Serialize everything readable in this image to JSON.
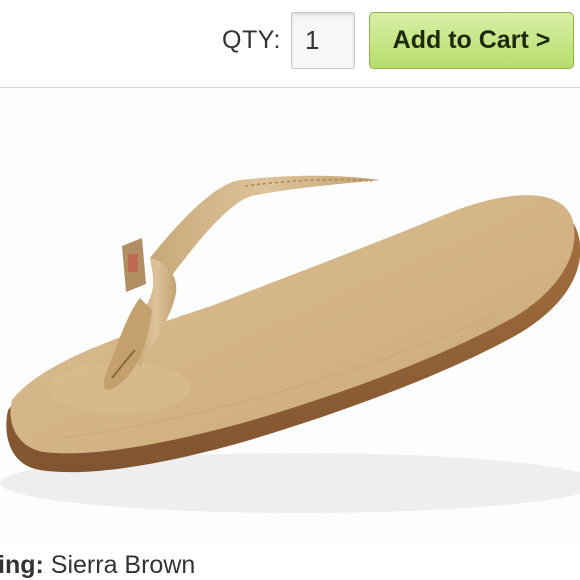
{
  "cart": {
    "qty_label": "QTY:",
    "qty_value": "1",
    "add_to_cart_label": "Add to Cart >"
  },
  "product": {
    "image_icon": "flip-flop-sandal-photo",
    "color_label": "ing:",
    "color_value": "Sierra Brown"
  },
  "colors": {
    "button_green": "#b6dc6c",
    "sandal_tan": "#d4b58a",
    "sole_brown": "#9c6a3c"
  }
}
